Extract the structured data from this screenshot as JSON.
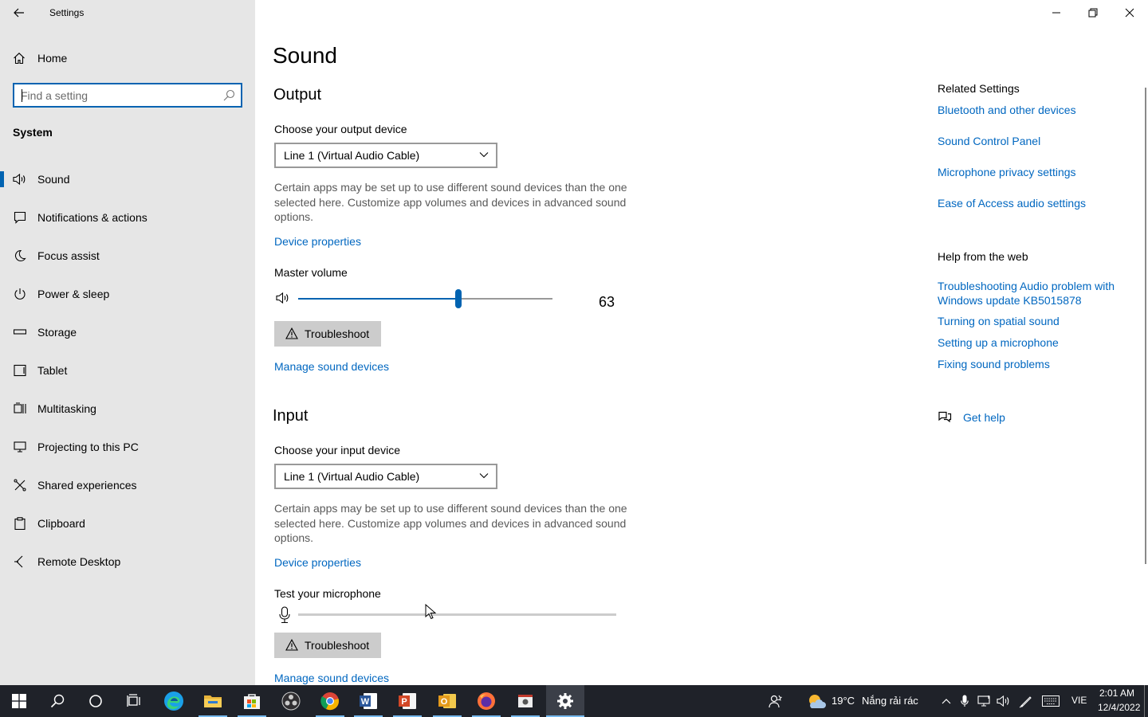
{
  "window": {
    "title": "Settings",
    "controls": [
      "minimize",
      "maximize",
      "close"
    ]
  },
  "sidebar": {
    "home_label": "Home",
    "search_placeholder": "Find a setting",
    "section_label": "System",
    "items": [
      {
        "label": "Sound",
        "icon": "speaker-icon",
        "active": true
      },
      {
        "label": "Notifications & actions",
        "icon": "notification-icon"
      },
      {
        "label": "Focus assist",
        "icon": "moon-icon"
      },
      {
        "label": "Power & sleep",
        "icon": "power-icon"
      },
      {
        "label": "Storage",
        "icon": "storage-icon"
      },
      {
        "label": "Tablet",
        "icon": "tablet-icon"
      },
      {
        "label": "Multitasking",
        "icon": "multitasking-icon"
      },
      {
        "label": "Projecting to this PC",
        "icon": "projector-icon"
      },
      {
        "label": "Shared experiences",
        "icon": "shared-icon"
      },
      {
        "label": "Clipboard",
        "icon": "clipboard-icon"
      },
      {
        "label": "Remote Desktop",
        "icon": "remote-desktop-icon"
      }
    ]
  },
  "main": {
    "title": "Sound",
    "output": {
      "heading": "Output",
      "device_label": "Choose your output device",
      "device_value": "Line 1 (Virtual Audio Cable)",
      "description": "Certain apps may be set up to use different sound devices than the one selected here. Customize app volumes and devices in advanced sound options.",
      "device_properties": "Device properties",
      "volume_label": "Master volume",
      "volume_value": "63",
      "volume_level": 0.63,
      "troubleshoot": "Troubleshoot",
      "manage": "Manage sound devices"
    },
    "input": {
      "heading": "Input",
      "device_label": "Choose your input device",
      "device_value": "Line 1 (Virtual Audio Cable)",
      "description": "Certain apps may be set up to use different sound devices than the one selected here. Customize app volumes and devices in advanced sound options.",
      "device_properties": "Device properties",
      "test_label": "Test your microphone",
      "troubleshoot": "Troubleshoot",
      "manage": "Manage sound devices"
    }
  },
  "related": {
    "heading": "Related Settings",
    "links": [
      "Bluetooth and other devices",
      "Sound Control Panel",
      "Microphone privacy settings",
      "Ease of Access audio settings"
    ]
  },
  "help": {
    "heading": "Help from the web",
    "links": [
      "Troubleshooting Audio problem with Windows update KB5015878",
      "Turning on spatial sound",
      "Setting up a microphone",
      "Fixing sound problems"
    ],
    "get_help": "Get help"
  },
  "taskbar": {
    "weather_temp": "19°C",
    "weather_text": "Nắng rải rác",
    "language": "VIE",
    "time": "2:01 AM",
    "date": "12/4/2022"
  },
  "colors": {
    "accent": "#0063b1",
    "link": "#0067c0",
    "sidebar_bg": "#e6e6e6",
    "taskbar_bg": "#1f2229"
  }
}
